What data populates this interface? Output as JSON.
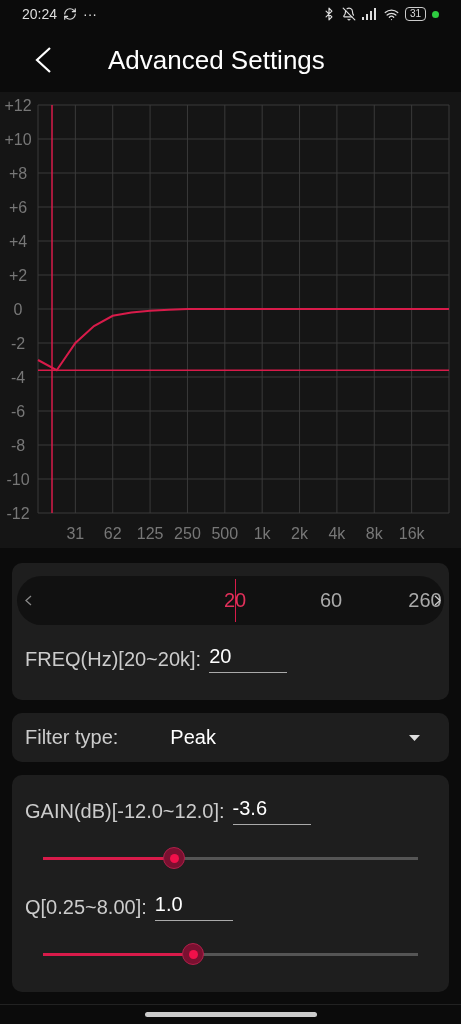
{
  "status_bar": {
    "time": "20:24",
    "more": "···",
    "battery": "31"
  },
  "header": {
    "title": "Advanced Settings"
  },
  "response_chart": {
    "chart_data": {
      "type": "line",
      "categories": [
        null,
        null,
        "31",
        null,
        "62",
        null,
        "125",
        null,
        "250",
        null,
        "500",
        null,
        "1k",
        null,
        "2k",
        null,
        "4k",
        null,
        "8k",
        null,
        "16k",
        null,
        null
      ],
      "values": [
        -3.0,
        -3.6,
        -2.0,
        -1.0,
        -0.4,
        -0.2,
        -0.1,
        -0.05,
        0,
        0,
        0,
        0,
        0,
        0,
        0,
        0,
        0,
        0,
        0,
        0,
        0,
        0,
        0
      ],
      "ylim": [
        -12,
        12
      ],
      "yticks": [
        {
          "value": 12,
          "label": "+12"
        },
        {
          "value": 10,
          "label": "+10"
        },
        {
          "value": 8,
          "label": "+8"
        },
        {
          "value": 6,
          "label": "+6"
        },
        {
          "value": 4,
          "label": "+4"
        },
        {
          "value": 2,
          "label": "+2"
        },
        {
          "value": 0,
          "label": "0"
        },
        {
          "value": -2,
          "label": "-2"
        },
        {
          "value": -4,
          "label": "-4"
        },
        {
          "value": -6,
          "label": "-6"
        },
        {
          "value": -8,
          "label": "-8"
        },
        {
          "value": -10,
          "label": "-10"
        },
        {
          "value": -12,
          "label": "-12"
        }
      ],
      "grid": true,
      "ref_lines": [
        {
          "axis": "y",
          "value": -3.6
        }
      ]
    }
  },
  "frequency": {
    "ruler": [
      {
        "label": "20",
        "selected": true
      },
      {
        "label": "60",
        "selected": false
      },
      {
        "label": "260",
        "selected": false
      }
    ],
    "label": "FREQ(Hz)[20~20k]:",
    "value": "20"
  },
  "filter": {
    "label": "Filter type:",
    "value": "Peak"
  },
  "gain": {
    "label": "GAIN(dB)[-12.0~12.0]:",
    "value": "-3.6",
    "level": 0.35
  },
  "q": {
    "label": "Q[0.25~8.00]:",
    "value": "1.0",
    "level": 0.4
  }
}
